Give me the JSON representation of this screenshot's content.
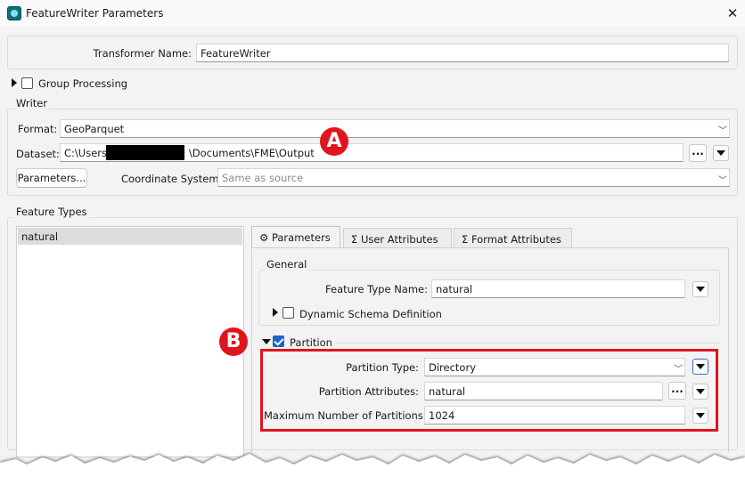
{
  "window": {
    "title": "FeatureWriter Parameters"
  },
  "transformer": {
    "label": "Transformer Name:",
    "value": "FeatureWriter"
  },
  "group_processing": {
    "label": "Group Processing",
    "checked": false
  },
  "writer": {
    "section_label": "Writer",
    "format_label": "Format:",
    "format_value": "GeoParquet",
    "dataset_label": "Dataset:",
    "dataset_prefix": "C:\\Users\\",
    "dataset_suffix": "\\Documents\\FME\\Output",
    "browse_label": "...",
    "parameters_button": "Parameters...",
    "coord_label": "Coordinate System:",
    "coord_placeholder": "Same as source"
  },
  "feature_types": {
    "section_label": "Feature Types",
    "items": [
      "natural"
    ]
  },
  "tabs": [
    {
      "label": "Parameters",
      "icon": "gear-icon",
      "active": true
    },
    {
      "label": "User Attributes",
      "icon": "sigma-icon",
      "active": false
    },
    {
      "label": "Format Attributes",
      "icon": "sigma-icon",
      "active": false
    }
  ],
  "general": {
    "section_label": "General",
    "feature_type_name_label": "Feature Type Name:",
    "feature_type_name_value": "natural",
    "dynamic_schema_label": "Dynamic Schema Definition",
    "dynamic_schema_checked": false
  },
  "partition": {
    "section_label": "Partition",
    "checked": true,
    "type_label": "Partition Type:",
    "type_value": "Directory",
    "attributes_label": "Partition Attributes:",
    "attributes_value": "natural",
    "browse_label": "...",
    "max_label": "Maximum Number of Partitions:",
    "max_value": "1024"
  },
  "annotations": {
    "marker_a": "A",
    "marker_b": "B",
    "accent": "#e1141c"
  }
}
